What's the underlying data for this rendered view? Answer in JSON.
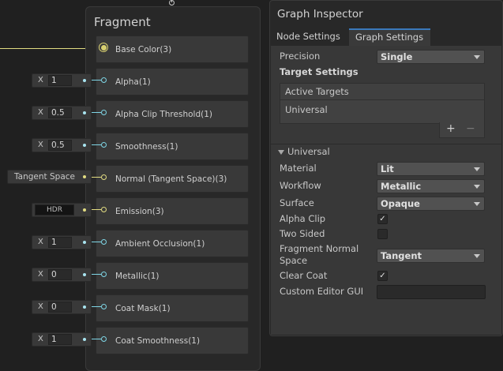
{
  "fragment": {
    "title": "Fragment",
    "ports": [
      {
        "label": "Base Color(3)"
      },
      {
        "label": "Alpha(1)"
      },
      {
        "label": "Alpha Clip Threshold(1)"
      },
      {
        "label": "Smoothness(1)"
      },
      {
        "label": "Normal (Tangent Space)(3)"
      },
      {
        "label": "Emission(3)"
      },
      {
        "label": "Ambient Occlusion(1)"
      },
      {
        "label": "Metallic(1)"
      },
      {
        "label": "Coat Mask(1)"
      },
      {
        "label": "Coat Smoothness(1)"
      }
    ]
  },
  "inputs": {
    "alpha": {
      "axis": "X",
      "value": "1"
    },
    "alpha_clip": {
      "axis": "X",
      "value": "0.5"
    },
    "smoothness": {
      "axis": "X",
      "value": "0.5"
    },
    "normal": {
      "text": "Tangent Space"
    },
    "emission": {
      "text": "HDR"
    },
    "ambient_occlusion": {
      "axis": "X",
      "value": "1"
    },
    "metallic": {
      "axis": "X",
      "value": "0"
    },
    "coat_mask": {
      "axis": "X",
      "value": "0"
    },
    "coat_smoothness": {
      "axis": "X",
      "value": "1"
    }
  },
  "inspector": {
    "title": "Graph Inspector",
    "tabs": [
      {
        "label": "Node Settings",
        "active": false
      },
      {
        "label": "Graph Settings",
        "active": true
      }
    ],
    "precision": {
      "label": "Precision",
      "value": "Single"
    },
    "target_settings": "Target Settings",
    "active_targets": {
      "header": "Active Targets",
      "items": [
        "Universal"
      ],
      "add": "+",
      "remove": "−"
    },
    "universal_section": "Universal",
    "fields": {
      "material": {
        "label": "Material",
        "value": "Lit"
      },
      "workflow": {
        "label": "Workflow",
        "value": "Metallic"
      },
      "surface": {
        "label": "Surface",
        "value": "Opaque"
      },
      "alpha_clip": {
        "label": "Alpha Clip",
        "checked": true
      },
      "two_sided": {
        "label": "Two Sided",
        "checked": false
      },
      "fragment_normal_space": {
        "label_line1": "Fragment Normal",
        "label_line2": "Space",
        "value": "Tangent"
      },
      "clear_coat": {
        "label": "Clear Coat",
        "checked": true
      },
      "custom_editor_gui": {
        "label": "Custom Editor GUI",
        "value": ""
      }
    }
  },
  "colors": {
    "background": "#202020",
    "node": "#282828",
    "port": "#393939",
    "vector1_wire": "#7fd6e6",
    "vector3_wire": "#e2dc82",
    "tab_accent": "#3a79bb"
  }
}
